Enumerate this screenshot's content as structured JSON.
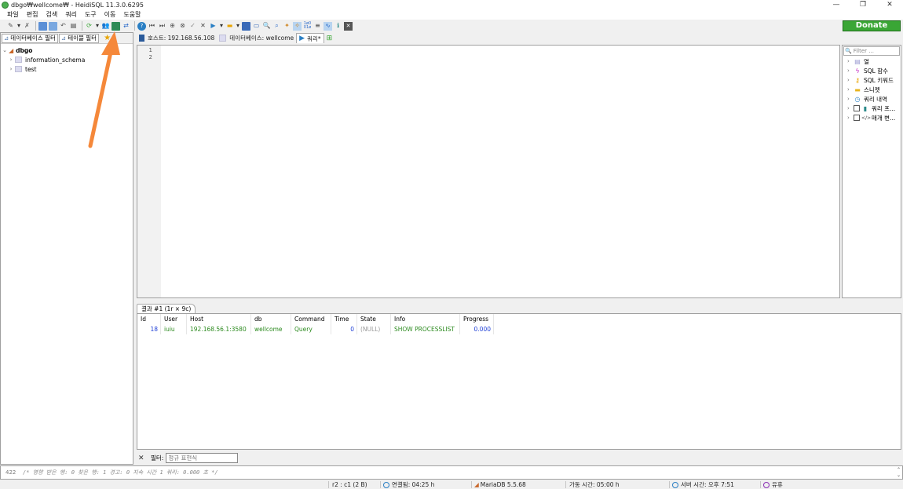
{
  "window": {
    "title": "dbgo₩wellcome₩ - HeidiSQL 11.3.0.6295",
    "controls": [
      "—",
      "❐",
      "✕"
    ]
  },
  "menu": [
    "파일",
    "편집",
    "검색",
    "쿼리",
    "도구",
    "이동",
    "도움말"
  ],
  "toolbar": {
    "donate_label": "Donate"
  },
  "left": {
    "filter_db": "데이터베이스 필터",
    "filter_table": "테이블 필터",
    "tree_root": "dbgo",
    "tree_children": [
      "information_schema",
      "test"
    ]
  },
  "tabs": {
    "host": "호스트: 192.168.56.108",
    "database": "데이터베이스: wellcome",
    "query": "쿼리*"
  },
  "editor": {
    "line_numbers": [
      "1",
      "2"
    ]
  },
  "right": {
    "filter_placeholder": "Filter ...",
    "items": [
      "열",
      "SQL 함수",
      "SQL 키워드",
      "스니펫",
      "쿼리 내역",
      "쿼리 프...",
      "매개 변..."
    ]
  },
  "results": {
    "tab_label": "결과 #1 (1r × 9c)",
    "columns": [
      "Id",
      "User",
      "Host",
      "db",
      "Command",
      "Time",
      "State",
      "Info",
      "Progress"
    ],
    "row": [
      "18",
      "iuiu",
      "192.168.56.1:3580",
      "wellcome",
      "Query",
      "0",
      "(NULL)",
      "SHOW PROCESSLIST",
      "0.000"
    ]
  },
  "filterbar": {
    "label": "필터:",
    "placeholder": "정규 표현식"
  },
  "log": {
    "line_num": "422",
    "text": "/* 영향 받은 행: 0 찾은 행: 1 경고: 0 지속 시간 1 쿼리: 0.000 초 */"
  },
  "status": {
    "cursor": "r2 : c1 (2 B)",
    "connected": "연결됨: 04:25 h",
    "server": "MariaDB 5.5.68",
    "uptime": "가동 시간: 05:00 h",
    "server_time": "서버 시간: 오후 7:51",
    "idle": "유휴"
  },
  "colors": {
    "accent_arrow": "#f5883a",
    "donate": "#3aa635",
    "num": "#1f3fd6",
    "str": "#2b8a1e"
  }
}
